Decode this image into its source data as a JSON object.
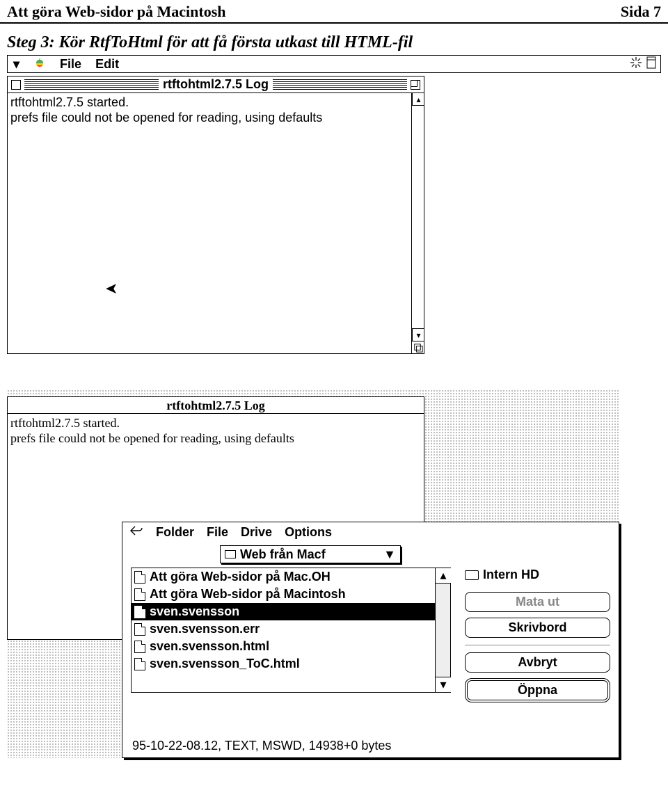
{
  "header": {
    "title_left": "Att göra Web-sidor på Macintosh",
    "title_right": "Sida 7"
  },
  "subtitle": "Steg 3: Kör RtfToHtml för att få första utkast till HTML-fil",
  "menubar": {
    "file": "File",
    "edit": "Edit"
  },
  "log_window": {
    "title": "rtftohtml2.7.5 Log",
    "line1": "rtftohtml2.7.5 started.",
    "line2": "prefs file could not be opened for reading, using defaults"
  },
  "log_window2": {
    "title": "rtftohtml2.7.5 Log",
    "line1": "rtftohtml2.7.5 started.",
    "line2": "prefs file could not be opened for reading, using defaults"
  },
  "dialog": {
    "menu_folder": "Folder",
    "menu_file": "File",
    "menu_drive": "Drive",
    "menu_options": "Options",
    "popup": "Web från Macf",
    "files": {
      "f0": "Att göra Web-sidor på Mac.OH",
      "f1": "Att göra Web-sidor på Macintosh",
      "f2": "sven.svensson",
      "f3": "sven.svensson.err",
      "f4": "sven.svensson.html",
      "f5": "sven.svensson_ToC.html"
    },
    "volume": "Intern HD",
    "btn_eject": "Mata ut",
    "btn_desktop": "Skrivbord",
    "btn_cancel": "Avbryt",
    "btn_open": "Öppna",
    "status": "95-10-22-08.12, TEXT, MSWD, 14938+0 bytes"
  }
}
